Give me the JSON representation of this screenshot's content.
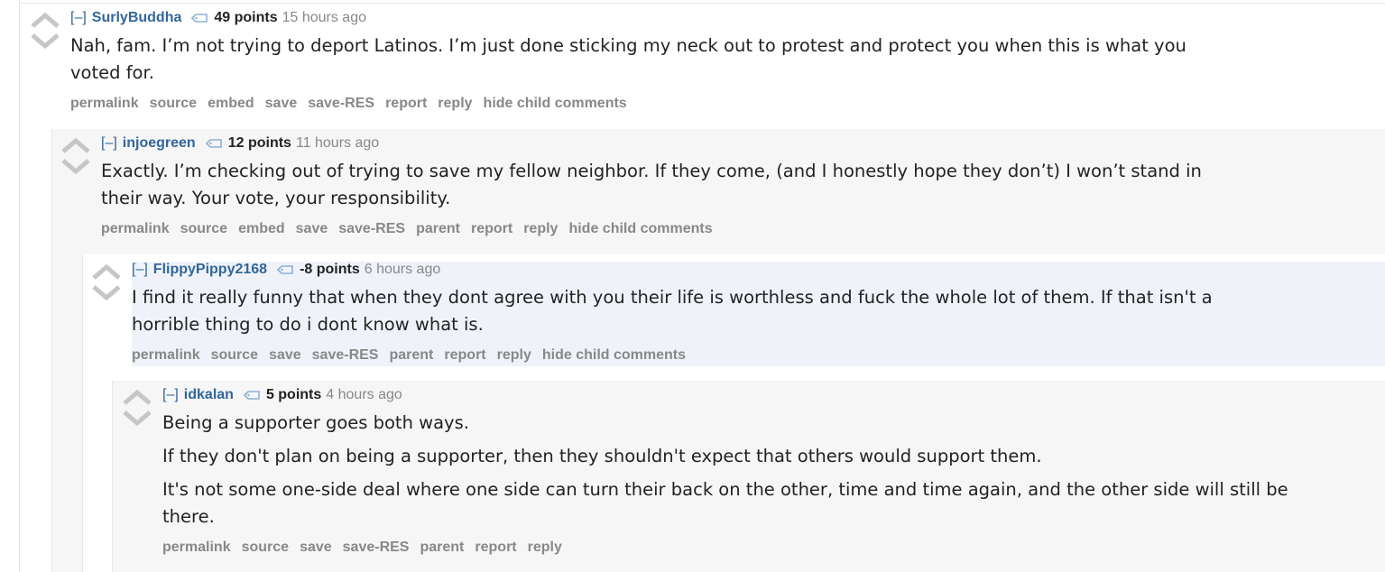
{
  "collapse_label": "[–]",
  "comments": [
    {
      "author": "SurlyBuddha",
      "score": "49 points",
      "time": "15 hours ago",
      "paragraphs": [
        "Nah, fam. I’m not trying to deport Latinos. I’m just done sticking my neck out to protest and protect you when this is what you voted for."
      ],
      "buttons": [
        "permalink",
        "source",
        "embed",
        "save",
        "save-RES",
        "report",
        "reply",
        "hide child comments"
      ]
    },
    {
      "author": "injoegreen",
      "score": "12 points",
      "time": "11 hours ago",
      "paragraphs": [
        "Exactly. I’m checking out of trying to save my fellow neighbor. If they come, (and I honestly hope they don’t) I won’t stand in their way. Your vote, your responsibility."
      ],
      "buttons": [
        "permalink",
        "source",
        "embed",
        "save",
        "save-RES",
        "parent",
        "report",
        "reply",
        "hide child comments"
      ]
    },
    {
      "author": "FlippyPippy2168",
      "score": "-8 points",
      "time": "6 hours ago",
      "paragraphs": [
        "I find it really funny that when they dont agree with you their life is worthless and fuck the whole lot of them. If that isn't a horrible thing to do i dont know what is."
      ],
      "buttons": [
        "permalink",
        "source",
        "save",
        "save-RES",
        "parent",
        "report",
        "reply",
        "hide child comments"
      ]
    },
    {
      "author": "idkalan",
      "score": "5 points",
      "time": "4 hours ago",
      "paragraphs": [
        "Being a supporter goes both ways.",
        "If they don't plan on being a supporter, then they shouldn't expect that others would support them.",
        "It's not some one-side deal where one side can turn their back on the other, time and time again, and the other side will still be there."
      ],
      "buttons": [
        "permalink",
        "source",
        "save",
        "save-RES",
        "parent",
        "report",
        "reply"
      ]
    }
  ],
  "colors": {
    "author": "#336699",
    "meta": "#888888",
    "body_text": "#222222",
    "arrow": "#c6c6c6",
    "highlight_bg": "#eff3f9",
    "nested_bg": "#f6f6f6"
  },
  "icons": {
    "upvote": "upvote-arrow-icon",
    "downvote": "downvote-arrow-icon",
    "flair": "tag-icon"
  }
}
